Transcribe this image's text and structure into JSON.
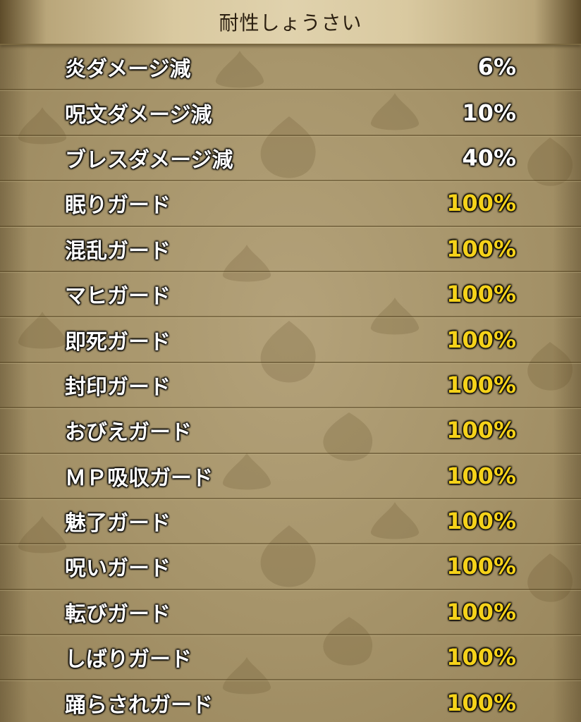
{
  "header": {
    "title": "耐性しょうさい"
  },
  "colors": {
    "normal_value": "#ffffff",
    "max_value": "#f5d21a",
    "panel": "#a8966c"
  },
  "resistances": [
    {
      "label": "炎ダメージ減",
      "value": "6%",
      "kind": "normal"
    },
    {
      "label": "呪文ダメージ減",
      "value": "10%",
      "kind": "normal"
    },
    {
      "label": "ブレスダメージ減",
      "value": "40%",
      "kind": "normal"
    },
    {
      "label": "眠りガード",
      "value": "100%",
      "kind": "max"
    },
    {
      "label": "混乱ガード",
      "value": "100%",
      "kind": "max"
    },
    {
      "label": "マヒガード",
      "value": "100%",
      "kind": "max"
    },
    {
      "label": "即死ガード",
      "value": "100%",
      "kind": "max"
    },
    {
      "label": "封印ガード",
      "value": "100%",
      "kind": "max"
    },
    {
      "label": "おびえガード",
      "value": "100%",
      "kind": "max"
    },
    {
      "label": "ＭＰ吸収ガード",
      "value": "100%",
      "kind": "max"
    },
    {
      "label": "魅了ガード",
      "value": "100%",
      "kind": "max"
    },
    {
      "label": "呪いガード",
      "value": "100%",
      "kind": "max"
    },
    {
      "label": "転びガード",
      "value": "100%",
      "kind": "max"
    },
    {
      "label": "しばりガード",
      "value": "100%",
      "kind": "max"
    },
    {
      "label": "踊らされガード",
      "value": "100%",
      "kind": "max"
    }
  ]
}
